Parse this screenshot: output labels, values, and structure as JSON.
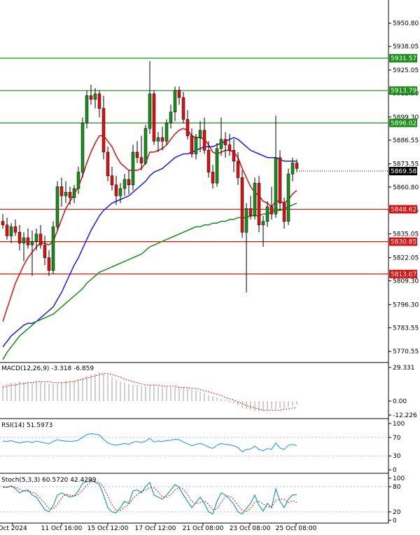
{
  "chart_data": [
    {
      "type": "candlestick",
      "ylim": [
        5766,
        5962
      ],
      "y_ticks": [
        "5950.80",
        "5938.05",
        "5925.05",
        "5912.30",
        "5899.30",
        "5886.55",
        "5873.55",
        "5860.80",
        "5848.05",
        "5835.05",
        "5822.05",
        "5809.30",
        "5796.30",
        "5783.55",
        "5770.55"
      ],
      "x_ticks": [
        "Oct 2024",
        "11 Oct 16:00",
        "15 Oct 12:00",
        "17 Oct 12:00",
        "21 Oct 08:00",
        "23 Oct 08:00",
        "25 Oct 08:00"
      ],
      "current_price": "5869.58",
      "levels": [
        {
          "label": "5931.57",
          "value": 5931.57,
          "color": "#1a8f1a"
        },
        {
          "label": "5913.79",
          "value": 5913.79,
          "color": "#1a8f1a"
        },
        {
          "label": "5896.02",
          "value": 5896.02,
          "color": "#1a8f1a"
        },
        {
          "label": "5848.62",
          "value": 5848.62,
          "color": "#e01010"
        },
        {
          "label": "5830.85",
          "value": 5830.85,
          "color": "#e01010"
        },
        {
          "label": "5813.07",
          "value": 5813.07,
          "color": "#e01010"
        }
      ],
      "candles": [
        [
          5842,
          5846,
          5838,
          5840
        ],
        [
          5840,
          5844,
          5832,
          5834
        ],
        [
          5834,
          5841,
          5830,
          5839
        ],
        [
          5839,
          5843,
          5834,
          5836
        ],
        [
          5836,
          5840,
          5826,
          5830
        ],
        [
          5830,
          5836,
          5820,
          5833
        ],
        [
          5833,
          5838,
          5827,
          5829
        ],
        [
          5829,
          5837,
          5812,
          5831
        ],
        [
          5831,
          5838,
          5826,
          5835
        ],
        [
          5835,
          5840,
          5827,
          5829
        ],
        [
          5829,
          5834,
          5818,
          5822
        ],
        [
          5822,
          5826,
          5812,
          5815
        ],
        [
          5815,
          5842,
          5813,
          5839
        ],
        [
          5839,
          5864,
          5837,
          5861
        ],
        [
          5861,
          5866,
          5850,
          5856
        ],
        [
          5856,
          5864,
          5852,
          5858
        ],
        [
          5858,
          5861,
          5851,
          5855
        ],
        [
          5855,
          5862,
          5852,
          5860
        ],
        [
          5860,
          5872,
          5857,
          5869
        ],
        [
          5869,
          5899,
          5866,
          5896
        ],
        [
          5896,
          5914,
          5893,
          5911
        ],
        [
          5911,
          5917,
          5906,
          5909
        ],
        [
          5909,
          5915,
          5904,
          5912
        ],
        [
          5912,
          5914,
          5899,
          5904
        ],
        [
          5904,
          5911,
          5876,
          5880
        ],
        [
          5880,
          5883,
          5864,
          5867
        ],
        [
          5867,
          5872,
          5859,
          5862
        ],
        [
          5862,
          5867,
          5851,
          5856
        ],
        [
          5856,
          5863,
          5852,
          5860
        ],
        [
          5860,
          5868,
          5856,
          5865
        ],
        [
          5865,
          5870,
          5857,
          5862
        ],
        [
          5862,
          5884,
          5859,
          5880
        ],
        [
          5880,
          5886,
          5874,
          5877
        ],
        [
          5877,
          5889,
          5870,
          5874
        ],
        [
          5874,
          5895,
          5873,
          5893
        ],
        [
          5893,
          5930,
          5890,
          5912
        ],
        [
          5912,
          5914,
          5884,
          5886
        ],
        [
          5886,
          5891,
          5880,
          5888
        ],
        [
          5888,
          5894,
          5881,
          5886
        ],
        [
          5886,
          5898,
          5884,
          5896
        ],
        [
          5896,
          5906,
          5893,
          5902
        ],
        [
          5902,
          5916,
          5897,
          5914
        ],
        [
          5914,
          5916,
          5906,
          5910
        ],
        [
          5910,
          5913,
          5896,
          5898
        ],
        [
          5898,
          5903,
          5887,
          5889
        ],
        [
          5889,
          5893,
          5877,
          5879
        ],
        [
          5879,
          5890,
          5876,
          5888
        ],
        [
          5888,
          5897,
          5880,
          5892
        ],
        [
          5892,
          5899,
          5879,
          5881
        ],
        [
          5881,
          5886,
          5866,
          5869
        ],
        [
          5869,
          5873,
          5860,
          5863
        ],
        [
          5863,
          5885,
          5861,
          5882
        ],
        [
          5882,
          5899,
          5878,
          5887
        ],
        [
          5887,
          5891,
          5877,
          5884
        ],
        [
          5884,
          5890,
          5878,
          5881
        ],
        [
          5881,
          5887,
          5869,
          5875
        ],
        [
          5875,
          5880,
          5862,
          5866
        ],
        [
          5866,
          5870,
          5833,
          5836
        ],
        [
          5836,
          5852,
          5803,
          5849
        ],
        [
          5849,
          5856,
          5843,
          5845
        ],
        [
          5845,
          5866,
          5843,
          5863
        ],
        [
          5863,
          5867,
          5836,
          5840
        ],
        [
          5840,
          5845,
          5828,
          5842
        ],
        [
          5842,
          5853,
          5839,
          5850
        ],
        [
          5850,
          5861,
          5843,
          5846
        ],
        [
          5846,
          5900,
          5844,
          5877
        ],
        [
          5877,
          5881,
          5848,
          5852
        ],
        [
          5852,
          5855,
          5838,
          5842
        ],
        [
          5842,
          5871,
          5840,
          5868
        ],
        [
          5868,
          5877,
          5864,
          5874
        ],
        [
          5874,
          5876,
          5869,
          5871
        ]
      ],
      "series": [
        {
          "name": "",
          "color": "#e01010",
          "values": [
            5787,
            5794,
            5801,
            5808,
            5813,
            5818,
            5822,
            5825,
            5828,
            5830,
            5830,
            5829,
            5831,
            5837,
            5843,
            5849,
            5853,
            5857,
            5861,
            5867,
            5874,
            5880,
            5885,
            5889,
            5889,
            5886,
            5883,
            5878,
            5874,
            5872,
            5870,
            5870,
            5870,
            5871,
            5874,
            5880,
            5880,
            5881,
            5882,
            5884,
            5887,
            5890,
            5892,
            5893,
            5892,
            5889,
            5888,
            5888,
            5887,
            5884,
            5880,
            5879,
            5880,
            5881,
            5881,
            5880,
            5877,
            5871,
            5866,
            5861,
            5858,
            5856,
            5853,
            5852,
            5850,
            5853,
            5853,
            5852,
            5854,
            5857,
            5859
          ]
        },
        {
          "name": "",
          "color": "#1a1aff",
          "values": [
            5773,
            5776,
            5779,
            5781,
            5783,
            5785,
            5786,
            5786,
            5787,
            5789,
            5791,
            5793,
            5795,
            5799,
            5803,
            5808,
            5813,
            5818,
            5822,
            5827,
            5832,
            5837,
            5841,
            5845,
            5848,
            5850,
            5852,
            5853,
            5854,
            5855,
            5856,
            5858,
            5860,
            5862,
            5864,
            5867,
            5869,
            5870,
            5871,
            5873,
            5875,
            5877,
            5878,
            5879,
            5879,
            5880,
            5881,
            5882,
            5883,
            5883,
            5883,
            5884,
            5885,
            5886,
            5887,
            5888,
            5887,
            5885,
            5883,
            5881,
            5880,
            5879,
            5878,
            5877,
            5877,
            5877,
            5876,
            5875,
            5875,
            5875,
            5875
          ]
        },
        {
          "name": "",
          "color": "#1a8f1a",
          "values": [
            5766,
            5770,
            5773,
            5776,
            5779,
            5781,
            5783,
            5785,
            5787,
            5788,
            5789,
            5790,
            5791,
            5793,
            5795,
            5797,
            5799,
            5801,
            5803,
            5805,
            5808,
            5810,
            5812,
            5814,
            5815,
            5816,
            5817,
            5818,
            5819,
            5820,
            5821,
            5822,
            5823,
            5824,
            5826,
            5828,
            5829,
            5830,
            5831,
            5832,
            5833,
            5834,
            5835,
            5836,
            5837,
            5838,
            5839,
            5839,
            5840,
            5840,
            5841,
            5841,
            5842,
            5842,
            5843,
            5843,
            5844,
            5844,
            5844,
            5845,
            5845,
            5845,
            5846,
            5846,
            5847,
            5848,
            5848,
            5849,
            5850,
            5851,
            5852
          ]
        }
      ]
    },
    {
      "type": "bar",
      "label": "MACD(12,26,9) -3.318 -6.859",
      "ylim": [
        -12.226,
        29.331
      ],
      "y_ticks": [
        "29.331",
        "0.00",
        "-12.226"
      ],
      "histogram": [
        14,
        15,
        16,
        16,
        17,
        17,
        17,
        16,
        17,
        17,
        16,
        15,
        15,
        16,
        17,
        18,
        18,
        18,
        19,
        20,
        22,
        23,
        24,
        25,
        24,
        23,
        21,
        19,
        17,
        16,
        15,
        14,
        14,
        13,
        13,
        14,
        14,
        13,
        12,
        12,
        12,
        12,
        12,
        12,
        11,
        10,
        9,
        8,
        7,
        5,
        4,
        3,
        2,
        1,
        -1,
        -2,
        -4,
        -6,
        -7,
        -8,
        -9,
        -9,
        -9,
        -8,
        -7,
        -7,
        -6,
        -6,
        -5,
        -4,
        -3
      ],
      "signal": [
        12,
        13,
        14,
        14,
        15,
        15,
        16,
        16,
        17,
        17,
        17,
        17,
        16,
        16,
        16,
        16,
        17,
        17,
        18,
        19,
        20,
        21,
        22,
        23,
        24,
        24,
        23,
        22,
        21,
        19,
        18,
        17,
        16,
        15,
        14,
        14,
        14,
        14,
        13,
        13,
        13,
        13,
        12,
        12,
        12,
        11,
        11,
        10,
        9,
        8,
        7,
        6,
        5,
        3,
        2,
        1,
        -1,
        -2,
        -4,
        -5,
        -6,
        -7,
        -8,
        -8,
        -8,
        -8,
        -8,
        -7,
        -7,
        -6,
        -6
      ]
    },
    {
      "type": "line",
      "label": "RSI(14) 51.5973",
      "ylim": [
        0,
        100
      ],
      "y_ticks": [
        "100",
        "70",
        "30",
        "0"
      ],
      "series": [
        {
          "name": "",
          "values": [
            62,
            61,
            63,
            60,
            58,
            60,
            61,
            59,
            62,
            60,
            58,
            56,
            61,
            65,
            63,
            62,
            61,
            62,
            64,
            70,
            76,
            78,
            77,
            75,
            66,
            58,
            55,
            53,
            55,
            57,
            55,
            60,
            61,
            59,
            62,
            68,
            60,
            62,
            61,
            63,
            64,
            66,
            65,
            60,
            56,
            52,
            55,
            57,
            54,
            49,
            46,
            53,
            57,
            55,
            54,
            52,
            48,
            39,
            44,
            45,
            51,
            44,
            41,
            46,
            44,
            58,
            47,
            44,
            53,
            55,
            52
          ]
        }
      ]
    },
    {
      "type": "line",
      "label": "Stoch(5,3,3) 60.5720 42.4299",
      "ylim": [
        0,
        100
      ],
      "y_ticks": [
        "100",
        "80",
        "20",
        "0"
      ],
      "series": [
        {
          "name": "",
          "values": [
            80,
            78,
            82,
            75,
            65,
            70,
            72,
            60,
            55,
            40,
            25,
            20,
            35,
            60,
            65,
            60,
            55,
            58,
            70,
            88,
            92,
            95,
            90,
            85,
            60,
            30,
            20,
            18,
            30,
            45,
            40,
            70,
            72,
            65,
            80,
            90,
            60,
            55,
            50,
            60,
            72,
            85,
            78,
            60,
            45,
            30,
            42,
            55,
            40,
            20,
            15,
            45,
            65,
            60,
            50,
            38,
            20,
            15,
            28,
            40,
            60,
            35,
            22,
            40,
            30,
            75,
            45,
            30,
            50,
            60,
            61
          ]
        },
        {
          "name": "",
          "values": [
            78,
            79,
            80,
            79,
            74,
            70,
            69,
            67,
            62,
            52,
            40,
            28,
            27,
            38,
            53,
            62,
            60,
            58,
            61,
            72,
            83,
            92,
            92,
            90,
            78,
            58,
            37,
            23,
            23,
            31,
            38,
            52,
            61,
            69,
            72,
            78,
            77,
            68,
            55,
            55,
            61,
            72,
            78,
            74,
            61,
            45,
            39,
            42,
            46,
            38,
            25,
            27,
            42,
            57,
            58,
            49,
            36,
            24,
            21,
            28,
            43,
            45,
            39,
            32,
            31,
            48,
            50,
            50,
            42,
            47,
            42
          ]
        }
      ]
    }
  ]
}
